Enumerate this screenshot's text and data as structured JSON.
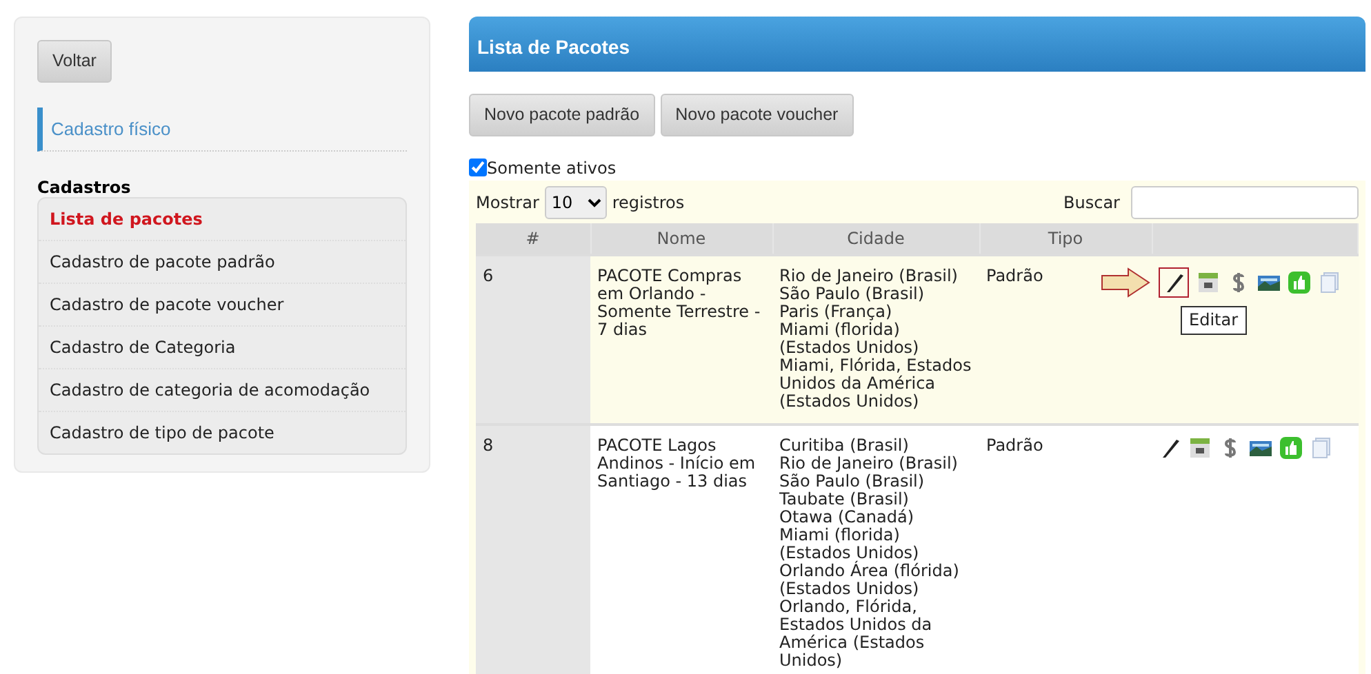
{
  "sidebar": {
    "back_button": "Voltar",
    "section_title": "Cadastro físico",
    "group_title": "Cadastros",
    "items": [
      {
        "label": "Lista de pacotes",
        "selected": true
      },
      {
        "label": "Cadastro de pacote padrão",
        "selected": false
      },
      {
        "label": "Cadastro de pacote voucher",
        "selected": false
      },
      {
        "label": "Cadastro de Categoria",
        "selected": false
      },
      {
        "label": "Cadastro de categoria de acomodação",
        "selected": false
      },
      {
        "label": "Cadastro de tipo de pacote",
        "selected": false
      }
    ]
  },
  "main": {
    "title": "Lista de Pacotes",
    "buttons": [
      "Novo pacote padrão",
      "Novo pacote voucher"
    ],
    "filter": {
      "label": "Somente ativos",
      "checked": true
    },
    "length": {
      "prefix": "Mostrar",
      "value": "10",
      "suffix": "registros"
    },
    "search": {
      "label": "Buscar"
    },
    "table": {
      "columns": [
        "#",
        "Nome",
        "Cidade",
        "Tipo"
      ],
      "rows": [
        {
          "id": "6",
          "name": "PACOTE Compras em Orlando - Somente Terrestre - 7 dias",
          "cities": [
            "Rio de Janeiro (Brasil)",
            "São Paulo (Brasil)",
            "Paris (França)",
            "Miami (florida) (Estados Unidos)",
            "Miami, Flórida, Estados Unidos da América (Estados Unidos)"
          ],
          "type": "Padrão",
          "pointed": true,
          "tooltip": "Editar"
        },
        {
          "id": "8",
          "name": "PACOTE Lagos Andinos - Início em Santiago - 13 dias",
          "cities": [
            "Curitiba (Brasil)",
            "Rio de Janeiro (Brasil)",
            "São Paulo (Brasil)",
            "Taubate (Brasil)",
            "Otawa (Canadá)",
            "Miami (florida) (Estados Unidos)",
            "Orlando Área (flórida) (Estados Unidos)",
            "Orlando, Flórida, Estados Unidos da América (Estados Unidos)"
          ],
          "type": "Padrão",
          "pointed": false
        }
      ],
      "actions": [
        {
          "kind": "edit"
        },
        {
          "kind": "calendar"
        },
        {
          "kind": "price"
        },
        {
          "kind": "image"
        },
        {
          "kind": "approve"
        },
        {
          "kind": "copy"
        }
      ]
    }
  }
}
